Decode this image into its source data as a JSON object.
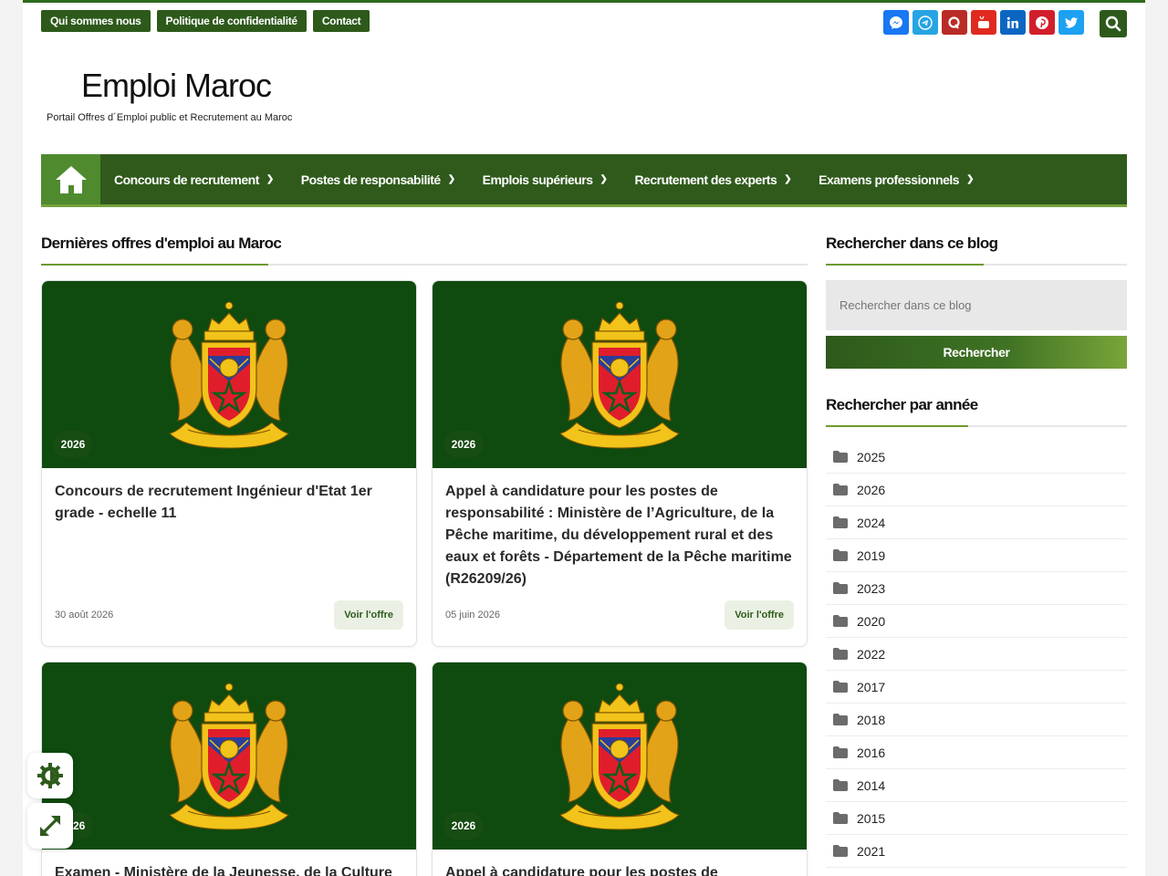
{
  "topbar": {
    "links": [
      "Qui sommes nous",
      "Politique de confidentialité",
      "Contact"
    ],
    "socials": [
      {
        "icon": "messenger-icon",
        "color": "#1877f2",
        "glyph": "✆"
      },
      {
        "icon": "telegram-icon",
        "color": "#26a4e3",
        "glyph": "➤"
      },
      {
        "icon": "quora-icon",
        "color": "#b92b27",
        "glyph": "Q"
      },
      {
        "icon": "youtube-icon",
        "color": "#e02a20",
        "glyph": "▶"
      },
      {
        "icon": "linkedin-icon",
        "color": "#0b66c2",
        "glyph": "in"
      },
      {
        "icon": "pinterest-icon",
        "color": "#d21e2b",
        "glyph": "P"
      },
      {
        "icon": "twitter-icon",
        "color": "#1da1f2",
        "glyph": "t"
      }
    ]
  },
  "brand": {
    "title": "Emploi Maroc",
    "subtitle": "Portail Offres d´Emploi public et Recrutement au Maroc"
  },
  "nav": {
    "items": [
      "Concours de recrutement",
      "Postes de responsabilité",
      "Emplois supérieurs",
      "Recrutement des experts",
      "Examens professionnels"
    ]
  },
  "main": {
    "heading": "Dernières offres d'emploi au Maroc",
    "cards": [
      {
        "badge": "2026",
        "title": "Concours de recrutement Ingénieur d'Etat 1er grade - echelle 11",
        "date": "30 août 2026",
        "button": "Voir l'offre"
      },
      {
        "badge": "2026",
        "title": "Appel à candidature pour les postes de responsabilité : Ministère de l’Agriculture, de la Pêche maritime, du développement rural et des eaux et forêts - Département de la Pêche maritime (R26209/26)",
        "date": "05 juin 2026",
        "button": "Voir l'offre"
      },
      {
        "badge": "2026",
        "title": "Examen - Ministère de la Jeunesse, de la Culture",
        "date": "",
        "button": ""
      },
      {
        "badge": "2026",
        "title": "Appel à candidature pour les postes de",
        "date": "",
        "button": ""
      }
    ]
  },
  "sidebar": {
    "search_heading": "Rechercher dans ce blog",
    "search_placeholder": "Rechercher dans ce blog",
    "search_button": "Rechercher",
    "years_heading": "Rechercher par année",
    "years": [
      "2025",
      "2026",
      "2024",
      "2019",
      "2023",
      "2020",
      "2022",
      "2017",
      "2018",
      "2016",
      "2014",
      "2015",
      "2021"
    ]
  },
  "colors": {
    "primary": "#2d5a1b",
    "accent": "#6b9a2f",
    "card_bg": "#0f4a0f"
  }
}
